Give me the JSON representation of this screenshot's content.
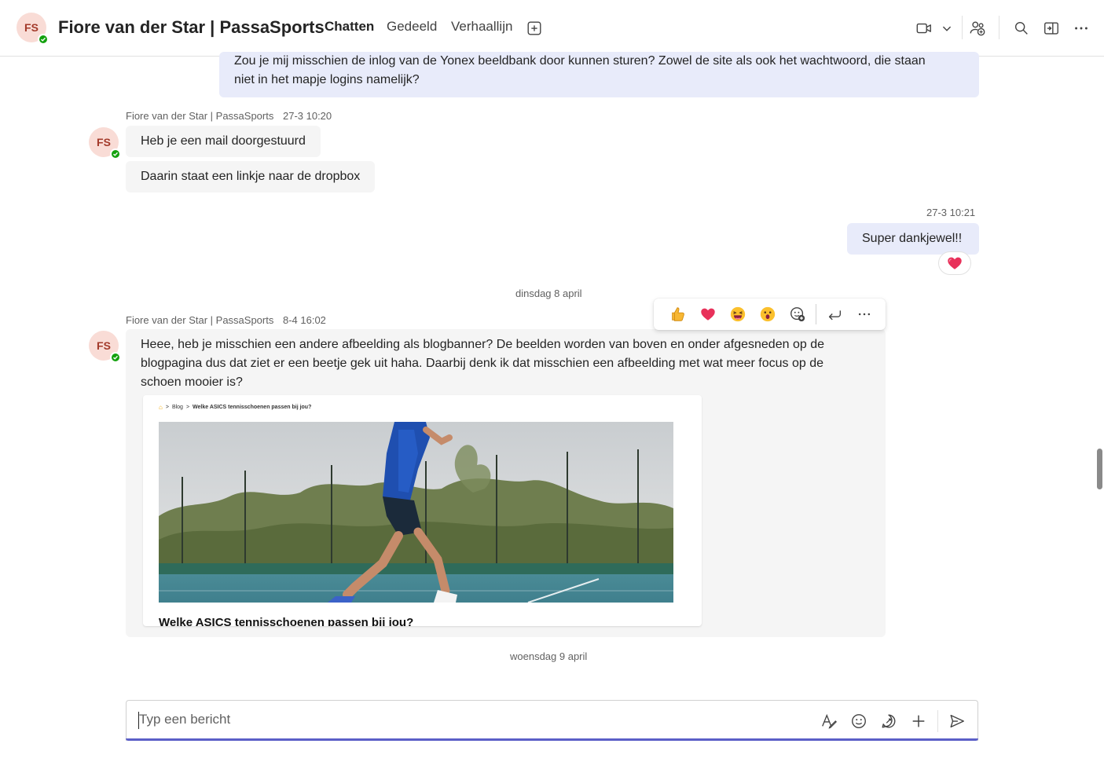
{
  "header": {
    "avatar_initials": "FS",
    "title": "Fiore van der Star | PassaSports",
    "tabs": [
      {
        "label": "Chatten",
        "active": true
      },
      {
        "label": "Gedeeld",
        "active": false
      },
      {
        "label": "Verhaallijn",
        "active": false
      }
    ],
    "icons": [
      "add-tab-icon",
      "video-call-icon",
      "chevron-down-icon",
      "people-add-icon",
      "search-icon",
      "popout-icon",
      "more-icon"
    ]
  },
  "messages": {
    "mine_1": {
      "text_line1": "Zou je mij misschien de inlog van de Yonex beeldbank door kunnen sturen? Zowel de site als ook het wachtwoord, die staan",
      "text_line2": "niet in het mapje logins namelijk?"
    },
    "other_1": {
      "author": "Fiore van der Star | PassaSports",
      "time": "27-3 10:20",
      "avatar_initials": "FS",
      "bubble_1": "Heb je een mail doorgestuurd",
      "bubble_2": "Daarin staat een linkje naar de dropbox"
    },
    "mine_2": {
      "time": "27-3 10:21",
      "text": "Super dankjewel!!",
      "reaction": "heart"
    },
    "date_divider_1": "dinsdag 8 april",
    "other_2": {
      "author": "Fiore van der Star | PassaSports",
      "time": "8-4 16:02",
      "avatar_initials": "FS",
      "text_line1": "Heee, heb je misschien een andere afbeelding als blogbanner? De beelden worden van boven en onder afgesneden op de",
      "text_line2": "blogpagina dus dat ziet er een beetje gek uit haha. Daarbij denk ik dat misschien een afbeelding met wat meer focus op de",
      "text_line3": "schoen mooier is?",
      "card": {
        "crumb_1": "Blog",
        "crumb_2": "Welke ASICS tennisschoenen passen bij jou?",
        "title": "Welke ASICS tennisschoenen passen bij jou?"
      }
    },
    "date_divider_2": "woensdag 9 april"
  },
  "reaction_bar": {
    "items": [
      "like-icon",
      "heart-icon",
      "laugh-icon",
      "surprised-icon",
      "add-reaction-icon",
      "reply-icon",
      "more-icon"
    ]
  },
  "compose": {
    "placeholder": "Typ een bericht",
    "icons": [
      "format-icon",
      "emoji-icon",
      "loop-icon",
      "attach-plus-icon",
      "send-icon"
    ]
  },
  "colors": {
    "accent": "#5b5fc7",
    "mine_bubble": "#e8ebfa",
    "other_bubble": "#f5f5f5",
    "presence": "#13a10e",
    "avatar_bg": "#f9dcd6"
  }
}
